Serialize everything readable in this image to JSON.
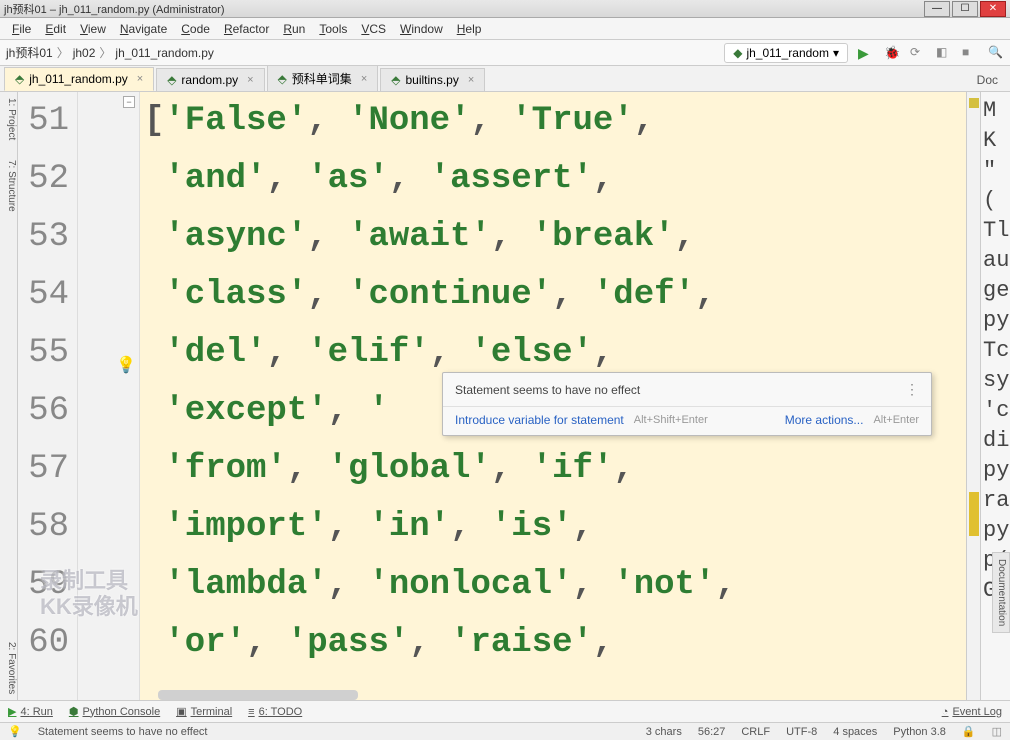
{
  "window": {
    "title": "jh预科01 – jh_011_random.py (Administrator)"
  },
  "menu": [
    "File",
    "Edit",
    "View",
    "Navigate",
    "Code",
    "Refactor",
    "Run",
    "Tools",
    "VCS",
    "Window",
    "Help"
  ],
  "breadcrumb": {
    "root": "jh预科01",
    "folder": "jh02",
    "file": "jh_011_random.py"
  },
  "run_config": {
    "name": "jh_011_random"
  },
  "tabs": [
    {
      "label": "jh_011_random.py",
      "active": true
    },
    {
      "label": "random.py",
      "active": false
    },
    {
      "label": "预科单词集",
      "active": false
    },
    {
      "label": "builtins.py",
      "active": false
    }
  ],
  "doc_tab": "Doc",
  "side_tools": {
    "project": "1: Project",
    "structure": "7: Structure",
    "favorites": "2: Favorites"
  },
  "editor": {
    "lines": [
      {
        "num": 51,
        "tokens": [
          "[",
          "'False'",
          ",",
          " ",
          "'None'",
          ",",
          " ",
          "'True'",
          ","
        ]
      },
      {
        "num": 52,
        "tokens": [
          " ",
          "'and'",
          ",",
          " ",
          "'as'",
          ",",
          " ",
          "'assert'",
          ","
        ]
      },
      {
        "num": 53,
        "tokens": [
          " ",
          "'async'",
          ",",
          " ",
          "'await'",
          ",",
          " ",
          "'break'",
          ","
        ]
      },
      {
        "num": 54,
        "tokens": [
          " ",
          "'class'",
          ",",
          " ",
          "'continue'",
          ",",
          " ",
          "'def'",
          ","
        ]
      },
      {
        "num": 55,
        "tokens": [
          " ",
          "'del'",
          ",",
          " ",
          "'elif'",
          ",",
          " ",
          "'else'",
          ","
        ]
      },
      {
        "num": 56,
        "tokens": [
          " ",
          "'except'",
          ",",
          " ",
          "'"
        ]
      },
      {
        "num": 57,
        "tokens": [
          " ",
          "'from'",
          ",",
          " ",
          "'global'",
          ",",
          " ",
          "'if'",
          ","
        ]
      },
      {
        "num": 58,
        "tokens": [
          " ",
          "'import'",
          ",",
          " ",
          "'in'",
          ",",
          " ",
          "'is'",
          ","
        ]
      },
      {
        "num": 59,
        "tokens": [
          " ",
          "'lambda'",
          ",",
          " ",
          "'nonlocal'",
          ",",
          " ",
          "'not'",
          ","
        ]
      },
      {
        "num": 60,
        "tokens": [
          " ",
          "'or'",
          ",",
          " ",
          "'pass'",
          ",",
          " ",
          "'raise'",
          ","
        ]
      }
    ]
  },
  "tooltip": {
    "message": "Statement seems to have no effect",
    "action1": "Introduce variable for statement",
    "shortcut1": "Alt+Shift+Enter",
    "action2": "More actions...",
    "shortcut2": "Alt+Enter"
  },
  "right_doc_text": "M\nK\n\"(\nTl\nau\nge\npy\n\nTc\nsy\n'c\ndi\npy\nra\n\npy\np(\nG",
  "right_vtab": "Documentation",
  "watermark": {
    "line1": "录制工具",
    "line2": "KK录像机"
  },
  "bottom_tools": {
    "run": "4: Run",
    "console": "Python Console",
    "terminal": "Terminal",
    "todo": "6: TODO",
    "eventlog": "Event Log"
  },
  "status": {
    "message": "Statement seems to have no effect",
    "chars": "3 chars",
    "pos": "56:27",
    "lineend": "CRLF",
    "encoding": "UTF-8",
    "indent": "4 spaces",
    "python": "Python 3.8"
  }
}
